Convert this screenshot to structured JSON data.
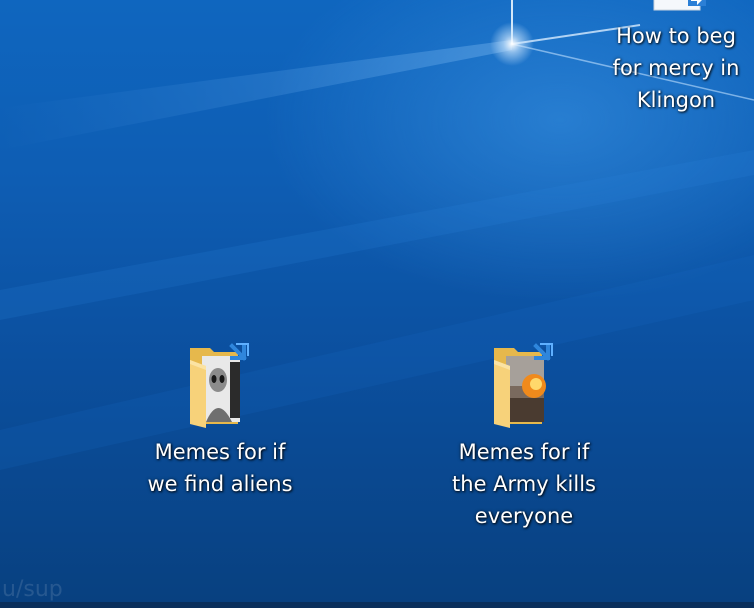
{
  "desktop": {
    "icons": [
      {
        "label_lines": [
          "How to beg",
          "for mercy in",
          "Klingon"
        ]
      },
      {
        "label_lines": [
          "Memes for if",
          "we find aliens"
        ]
      },
      {
        "label_lines": [
          "Memes for if",
          "the Army kills",
          "everyone"
        ]
      }
    ]
  },
  "watermark": "u/sup"
}
